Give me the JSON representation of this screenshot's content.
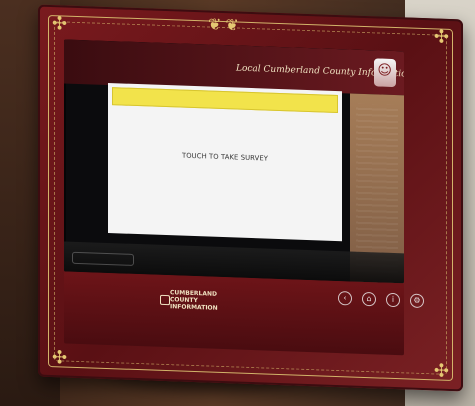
{
  "kiosk": {
    "header_title": "Local Cumberland County Information",
    "screen_text": "TOUCH TO TAKE SURVEY",
    "logo_text": "CUMBERLAND\nCOUNTY\nINFORMATION"
  },
  "icons": {
    "mascot": "person-icon",
    "controls": [
      "back-icon",
      "home-icon",
      "info-icon",
      "tools-icon"
    ]
  }
}
